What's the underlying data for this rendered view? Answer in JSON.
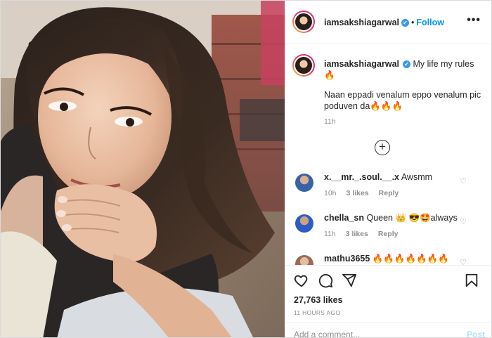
{
  "post": {
    "username": "iamsakshiagarwal",
    "verified_mark": "✔",
    "separator": "•",
    "follow_label": "Follow",
    "more_icon": "more-horizontal-icon",
    "more_label": "•••"
  },
  "caption": {
    "username": "iamsakshiagarwal",
    "line1": "My life my rules 🔥",
    "line2": "Naan eppadi venalum eppo venalum pic poduven da🔥🔥🔥",
    "time": "11h",
    "load_more_label": "+"
  },
  "comments": [
    {
      "username": "x.__mr._.soul.__.x",
      "text": "Awsmm",
      "time": "10h",
      "likes": "3 likes",
      "reply": "Reply"
    },
    {
      "username": "chella_sn",
      "text": "Queen 👑 😎🤩always",
      "time": "11h",
      "likes": "3 likes",
      "reply": "Reply"
    },
    {
      "username": "mathu3655",
      "text": "🔥🔥🔥🔥🔥🔥🔥",
      "time": "",
      "likes": "",
      "reply": ""
    }
  ],
  "actions": {
    "like_icon": "heart-icon",
    "comment_icon": "comment-icon",
    "share_icon": "share-icon",
    "save_icon": "bookmark-icon",
    "likes": "27,763 likes",
    "posted": "11 HOURS AGO",
    "add_comment_placeholder": "Add a comment...",
    "post_label": "Post"
  },
  "colors": {
    "link_blue": "#0095f6",
    "verified_blue": "#3897f0",
    "muted_text": "#8e8e8e",
    "border": "#efefef"
  }
}
